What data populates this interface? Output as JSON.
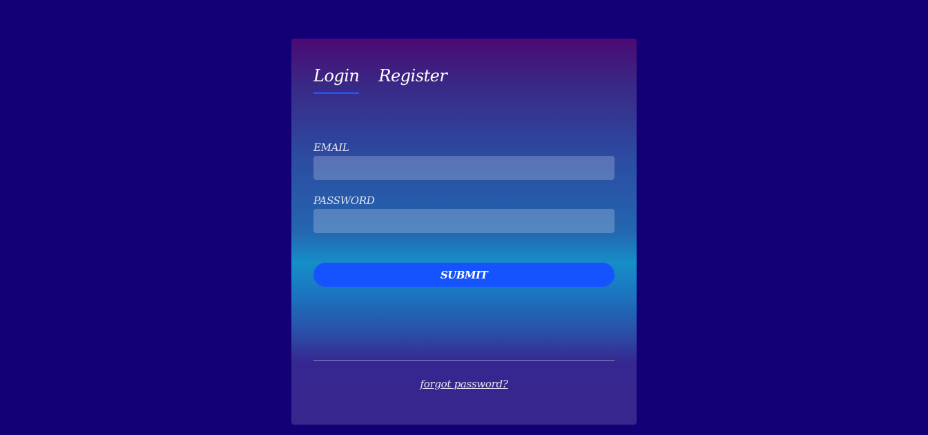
{
  "tabs": [
    {
      "label": "Login",
      "active": true
    },
    {
      "label": "Register",
      "active": false
    }
  ],
  "form": {
    "email_label": "EMAIL",
    "email_value": "",
    "password_label": "PASSWORD",
    "password_value": "",
    "submit_label": "SUBMIT"
  },
  "footer": {
    "forgot_label": "forgot password?"
  },
  "colors": {
    "page_background": "#140076",
    "accent": "#1553ff",
    "text": "#ffffff"
  }
}
